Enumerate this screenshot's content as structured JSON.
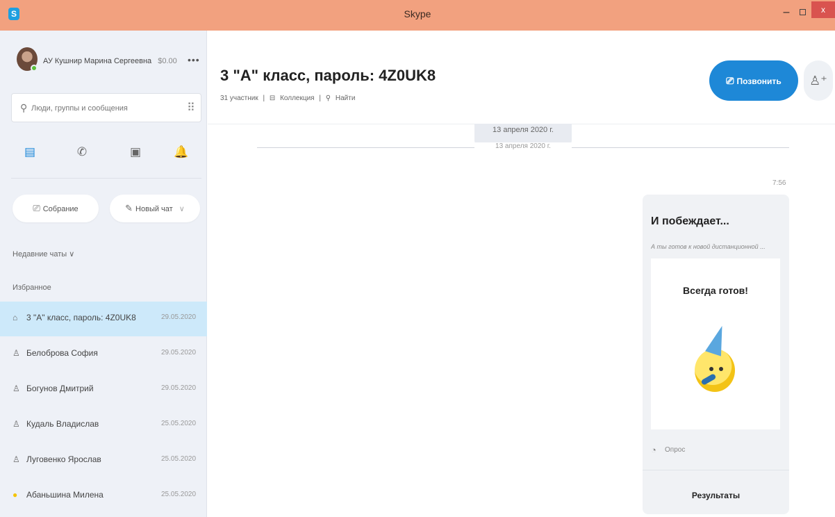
{
  "window": {
    "title": "Skype",
    "app_icon": "S",
    "minimize": "–",
    "close": "x"
  },
  "profile": {
    "name": "АУ Кушнир Марина Сергеевна",
    "balance": "$0.00",
    "more": "•••"
  },
  "search": {
    "placeholder": "Люди, группы и сообщения"
  },
  "nav": {
    "chats_icon": "▤",
    "calls_icon": "✆",
    "contacts_icon": "▣",
    "notifications_icon": "🔔"
  },
  "actions": {
    "meeting_label": "Собрание",
    "new_chat_label": "Новый чат",
    "chevron": "∨"
  },
  "sections": {
    "recent": "Недавние чаты ∨",
    "favorites": "Избранное"
  },
  "chats": [
    {
      "icon": "group-icon",
      "glyph": "⌂",
      "name": "3 \"А\" класс, пароль: 4Z0UK8",
      "date": "29.05.2020",
      "active": true
    },
    {
      "icon": "person-icon",
      "glyph": "♙",
      "name": "Белоброва София",
      "date": "29.05.2020"
    },
    {
      "icon": "person-icon",
      "glyph": "♙",
      "name": "Богунов Дмитрий",
      "date": "29.05.2020"
    },
    {
      "icon": "person-icon",
      "glyph": "♙",
      "name": "Кудаль Владислав",
      "date": "25.05.2020"
    },
    {
      "icon": "person-icon",
      "glyph": "♙",
      "name": "Луговенко Ярослав",
      "date": "25.05.2020"
    },
    {
      "icon": "status-away-icon",
      "glyph": "●",
      "name": "Абаньшина Милена",
      "date": "25.05.2020"
    }
  ],
  "conversation": {
    "title": "3 \"А\" класс, пароль: 4Z0UK8",
    "participants": "31 участник",
    "collection": "Коллекция",
    "find": "Найти",
    "call_label": "Позвонить",
    "date_separator": "13 апреля 2020 г.",
    "message_time": "7:56"
  },
  "poll": {
    "title": "И побеждает...",
    "subtitle": "А ты готов к новой дистанционной ...",
    "winning_option": "Всегда готов!",
    "type_label": "Опрос",
    "results_label": "Результаты"
  },
  "colors": {
    "titlebar": "#f2a17f",
    "accent": "#1e88d7",
    "sidebar": "#eef1f7",
    "active_row": "#cde9fa"
  }
}
